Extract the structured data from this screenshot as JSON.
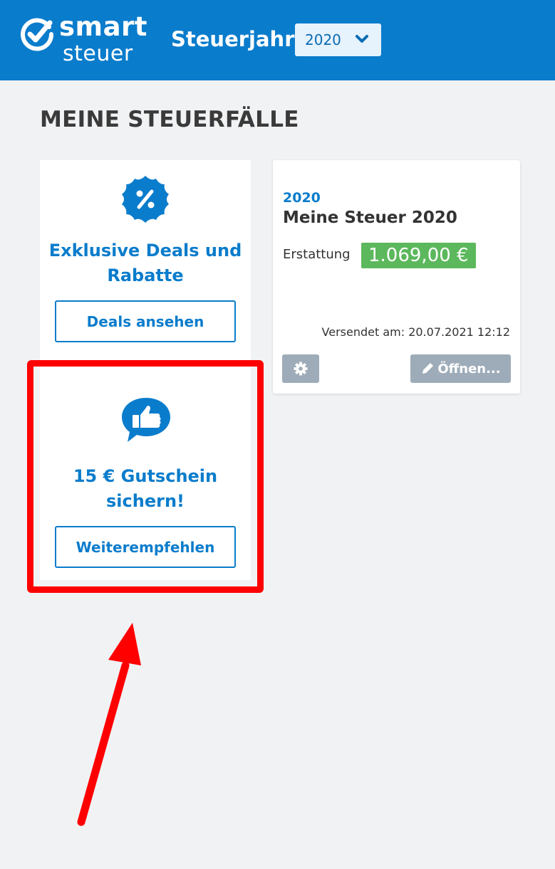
{
  "header": {
    "logo_primary": "smart",
    "logo_secondary": "steuer",
    "tax_year_label": "Steuerjahr",
    "tax_year_selected": "2020",
    "background_color": "#0a7ccc"
  },
  "page_title": "MEINE STEUERFÄLLE",
  "deals_card": {
    "icon": "percent-badge-icon",
    "heading_line1": "Exklusive Deals und",
    "heading_line2": "Rabatte",
    "button_label": "Deals ansehen"
  },
  "referral_card": {
    "icon": "thumbs-up-speech-bubble-icon",
    "heading_line1": "15 € Gutschein",
    "heading_line2": "sichern!",
    "button_label": "Weiterempfehlen",
    "highlight_color": "#ff0000"
  },
  "tax_case": {
    "year": "2020",
    "title": "Meine Steuer 2020",
    "refund_label": "Erstattung",
    "refund_amount": "1.069,00 €",
    "sent_text": "Versendet am: 20.07.2021 12:12",
    "settings_icon": "gear-icon",
    "open_icon": "pencil-icon",
    "open_label": "Öffnen..."
  },
  "colors": {
    "accent": "#0a7ccc",
    "refund_green": "#5cb85c",
    "muted_button": "#9eacb9"
  }
}
